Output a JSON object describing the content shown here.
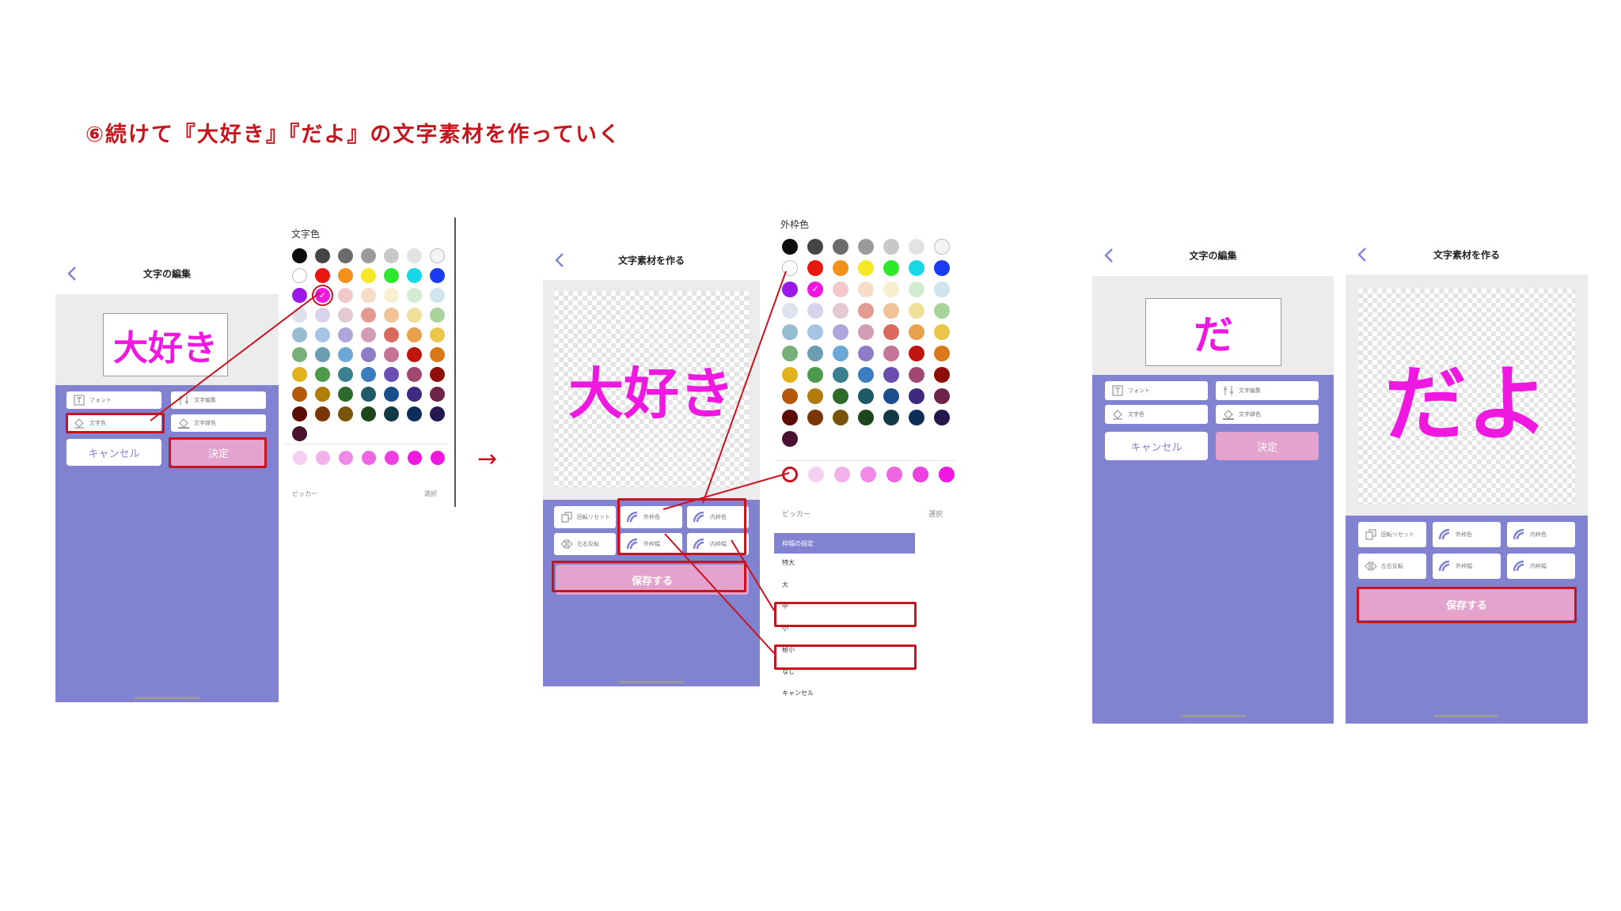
{
  "title": "⑥続けて『大好き』『だよ』の文字素材を作っていく",
  "phone1": {
    "header_title": "文字の編集",
    "preview_text": "大好き",
    "buttons": [
      "フォント",
      "文字編集",
      "文字色",
      "文字縁色"
    ],
    "cancel_label": "キャンセル",
    "ok_label": "決定"
  },
  "palette1": {
    "label": "文字色",
    "picker_label": "ピッカー",
    "select_label": "選択",
    "colors": [
      "#0d0d0d",
      "#444444",
      "#6b6b6b",
      "#9a9a9a",
      "#c8c8c8",
      "#e3e3e3",
      "#f3f3f3",
      "#ffffff",
      "#e8170f",
      "#f3911a",
      "#f7e826",
      "#2ee82e",
      "#18d8e8",
      "#1a3cf0",
      "#9a18e8",
      "#ee18e0",
      "#f2c8c8",
      "#f7dcc8",
      "#f7efcf",
      "#d2ecd2",
      "#d0e4ee",
      "#dde2ec",
      "#d8d2ec",
      "#e4c8d2",
      "#e49a92",
      "#f0c296",
      "#f0df98",
      "#a8d49c",
      "#96bcd2",
      "#a4c6e4",
      "#b0a4dc",
      "#d29cb4",
      "#d96a5e",
      "#e8a24c",
      "#eac64c",
      "#78b07a",
      "#6a9eb0",
      "#6aa8d8",
      "#8e7cc8",
      "#c47496",
      "#c0150f",
      "#d8781a",
      "#e2b21c",
      "#4e9a4c",
      "#3a8090",
      "#3a7ec0",
      "#6a4eb0",
      "#a04870",
      "#8e0f0a",
      "#b4580c",
      "#b07c0c",
      "#2c6a2c",
      "#1e5a68",
      "#1a4e8c",
      "#3e2a80",
      "#6e2448",
      "#5c0c06",
      "#7a3606",
      "#7a540a",
      "#1c461c",
      "#123a44",
      "#0e2e5a",
      "#24184e",
      "#4a1230"
    ],
    "history": [
      "#f6d0f2",
      "#f2b0ec",
      "#f08ae8",
      "#ee66e4",
      "#ee40e0",
      "#ee18e0",
      "#ee18e0"
    ]
  },
  "phone2": {
    "header_title": "文字素材を作る",
    "preview_text": "大好き",
    "buttons": [
      "回転リセット",
      "外枠色",
      "内枠色",
      "左右反転",
      "外枠幅",
      "内枠幅"
    ],
    "save_label": "保存する"
  },
  "palette2": {
    "label": "外枠色",
    "picker_label": "ピッカー",
    "select_label": "選択",
    "colors": [
      "#0d0d0d",
      "#444444",
      "#6b6b6b",
      "#9a9a9a",
      "#c8c8c8",
      "#e3e3e3",
      "#f3f3f3",
      "#ffffff",
      "#e8170f",
      "#f3911a",
      "#f7e826",
      "#2ee82e",
      "#18d8e8",
      "#1a3cf0",
      "#9a18e8",
      "#ee18e0",
      "#f2c8c8",
      "#f7dcc8",
      "#f7efcf",
      "#d2ecd2",
      "#d0e4ee",
      "#dde2ec",
      "#d8d2ec",
      "#e4c8d2",
      "#e49a92",
      "#f0c296",
      "#f0df98",
      "#a8d49c",
      "#96bcd2",
      "#a4c6e4",
      "#b0a4dc",
      "#d29cb4",
      "#d96a5e",
      "#e8a24c",
      "#eac64c",
      "#78b07a",
      "#6a9eb0",
      "#6aa8d8",
      "#8e7cc8",
      "#c47496",
      "#c0150f",
      "#d8781a",
      "#e2b21c",
      "#4e9a4c",
      "#3a8090",
      "#3a7ec0",
      "#6a4eb0",
      "#a04870",
      "#8e0f0a",
      "#b4580c",
      "#b07c0c",
      "#2c6a2c",
      "#1e5a68",
      "#1a4e8c",
      "#3e2a80",
      "#6e2448",
      "#5c0c06",
      "#7a3606",
      "#7a540a",
      "#1c461c",
      "#123a44",
      "#0e2e5a",
      "#24184e",
      "#4a1230"
    ],
    "history": [
      "#ffffff",
      "#f6d0f2",
      "#f2b0ec",
      "#f08ae8",
      "#ee66e4",
      "#ee40e0",
      "#ee18e0",
      "#ee18e0"
    ]
  },
  "width_menu": {
    "header": "枠幅の指定",
    "items": [
      "特大",
      "大",
      "中",
      "小",
      "極小",
      "なし",
      "キャンセル"
    ]
  },
  "phone3": {
    "header_title": "文字の編集",
    "preview_text": "だ",
    "buttons": [
      "フォント",
      "文字編集",
      "文字色",
      "文字縁色"
    ],
    "cancel_label": "キャンセル",
    "ok_label": "決定"
  },
  "phone4": {
    "header_title": "文字素材を作る",
    "preview_text": "だよ",
    "buttons": [
      "回転リセット",
      "外枠色",
      "内枠色",
      "左右反転",
      "外枠幅",
      "内枠幅"
    ],
    "save_label": "保存する"
  },
  "next_arrow": "→",
  "colors": {
    "accent_red": "#c8121f",
    "app_purple": "#8182d0",
    "pink_button": "#e4a3cc",
    "text_magenta": "#ee18e0"
  }
}
